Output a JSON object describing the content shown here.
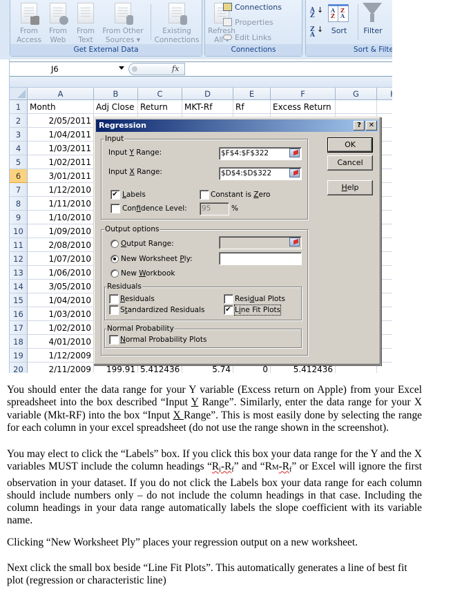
{
  "ribbon": {
    "groups": {
      "get_external_data": {
        "label": "Get External Data",
        "buttons": [
          {
            "line1": "From",
            "line2": "Access",
            "icon": "from-access-icon"
          },
          {
            "line1": "From",
            "line2": "Web",
            "icon": "from-web-icon"
          },
          {
            "line1": "From",
            "line2": "Text",
            "icon": "from-text-icon"
          },
          {
            "line1": "From Other",
            "line2": "Sources ▾",
            "icon": "from-other-sources-icon"
          },
          {
            "line1": "Existing",
            "line2": "Connections",
            "icon": "existing-connections-icon"
          }
        ]
      },
      "connections": {
        "label": "Connections",
        "refresh": {
          "line1": "Refresh",
          "line2": "All ▾"
        },
        "items": [
          "Connections",
          "Properties",
          "Edit Links"
        ]
      },
      "sort_filter": {
        "label": "Sort & Filte",
        "sort_az": "A Z",
        "sort_za": "Z A",
        "sort_label": "Sort",
        "filter_label": "Filter"
      }
    }
  },
  "formula_bar": {
    "name_box": "J6",
    "fx": "fx",
    "value": ""
  },
  "sheet": {
    "columns": [
      "A",
      "B",
      "C",
      "D",
      "E",
      "F",
      "G",
      "H"
    ],
    "row_numbers": [
      "1",
      "2",
      "3",
      "4",
      "5",
      "6",
      "7",
      "8",
      "9",
      "10",
      "11",
      "12",
      "13",
      "14",
      "15",
      "16",
      "17",
      "18",
      "19",
      "20"
    ],
    "active_row": "6",
    "header_row": [
      "Month",
      "Adj Close",
      "Return",
      "MKT-Rf",
      "Rf",
      "Excess Return",
      "",
      ""
    ],
    "month_values": [
      "2/05/2011",
      "1/04/2011",
      "1/03/2011",
      "1/02/2011",
      "3/01/2011",
      "1/12/2010",
      "1/11/2010",
      "1/10/2010",
      "1/09/2010",
      "2/08/2010",
      "1/07/2010",
      "1/06/2010",
      "3/05/2010",
      "1/04/2010",
      "1/03/2010",
      "1/02/2010",
      "4/01/2010",
      "1/12/2009",
      "2/11/2009"
    ],
    "row20_partial": [
      "199.91",
      "5.412436",
      "5.74",
      "0",
      "5.412436"
    ]
  },
  "dialog": {
    "title": "Regression",
    "help_glyph": "?",
    "close_glyph": "✕",
    "input_legend": "Input",
    "input_y": {
      "label_pre": "Input ",
      "label_key": "Y",
      "label_post": " Range:",
      "value": "$F$4:$F$322"
    },
    "input_x": {
      "label_pre": "Input ",
      "label_key": "X",
      "label_post": " Range:",
      "value": "$D$4:$D$322"
    },
    "labels": {
      "key": "L",
      "rest": "abels",
      "checked": true
    },
    "constant_zero": {
      "pre": "Constant is ",
      "key": "Z",
      "rest": "ero",
      "checked": false
    },
    "confidence": {
      "pre": "Con",
      "key": "f",
      "rest": "idence Level:",
      "checked": false,
      "value": "95",
      "unit": "%"
    },
    "buttons": {
      "ok": "OK",
      "cancel": "Cancel",
      "help_key": "H",
      "help_rest": "elp"
    },
    "output_legend": "Output options",
    "output_range": {
      "key": "O",
      "rest": "utput Range:",
      "selected": false,
      "value": ""
    },
    "new_sheet": {
      "pre": "New Worksheet ",
      "key": "P",
      "rest": "ly:",
      "selected": true,
      "value": ""
    },
    "new_workbook": {
      "pre": "New ",
      "key": "W",
      "rest": "orkbook",
      "selected": false
    },
    "residuals_legend": "Residuals",
    "residuals": {
      "key": "R",
      "rest": "esiduals",
      "checked": false
    },
    "std_residuals": {
      "pre": "S",
      "key": "t",
      "rest": "andardized Residuals",
      "checked": false
    },
    "residual_plots": {
      "pre": "Resi",
      "key": "d",
      "rest": "ual Plots",
      "checked": false
    },
    "line_fit": {
      "pre": "L",
      "key": "i",
      "rest": "ne Fit Plots",
      "checked": true
    },
    "normal_legend": "Normal Probability",
    "normal_plots": {
      "key": "N",
      "rest": "ormal Probability Plots",
      "checked": false
    }
  },
  "document": {
    "p1": {
      "a": "You should enter the data range for your Y variable (Excess return on Apple) from your Excel spreadsheet into the box described “Input ",
      "a_u": "Y",
      "b": " Range”. Similarly, enter the data range for your X variable (Mkt-RF) into the box “Input ",
      "b_u": "X ",
      "c": "Range”. This is most easily done by selecting the range for each column in your excel spreadsheet (do not use the range shown in the screenshot)."
    },
    "p2": {
      "a": "You may elect to click the “Labels” box. If you click this box your data range for the Y and the X variables MUST include the column headings “",
      "ri": "R",
      "ri_sub": "i",
      "dash1": "-R",
      "rf1_sub": "f",
      "mid": "” and “R",
      "rm_sub": "M",
      "dash2": "-R",
      "rf2_sub": "f",
      "b": "” or Excel will ignore the first observation in your dataset. If you do not click the Labels box your data range for each column should include numbers only – do not include the column headings in that case. Including the column headings in your data range automatically labels the slope coefficient with its variable name."
    },
    "p3": "Clicking “New Worksheet Ply” places your regression output on a new worksheet.",
    "p4": "Next click the small box beside “Line Fit Plots”. This automatically generates a line of best fit plot (regression or characteristic line)"
  }
}
